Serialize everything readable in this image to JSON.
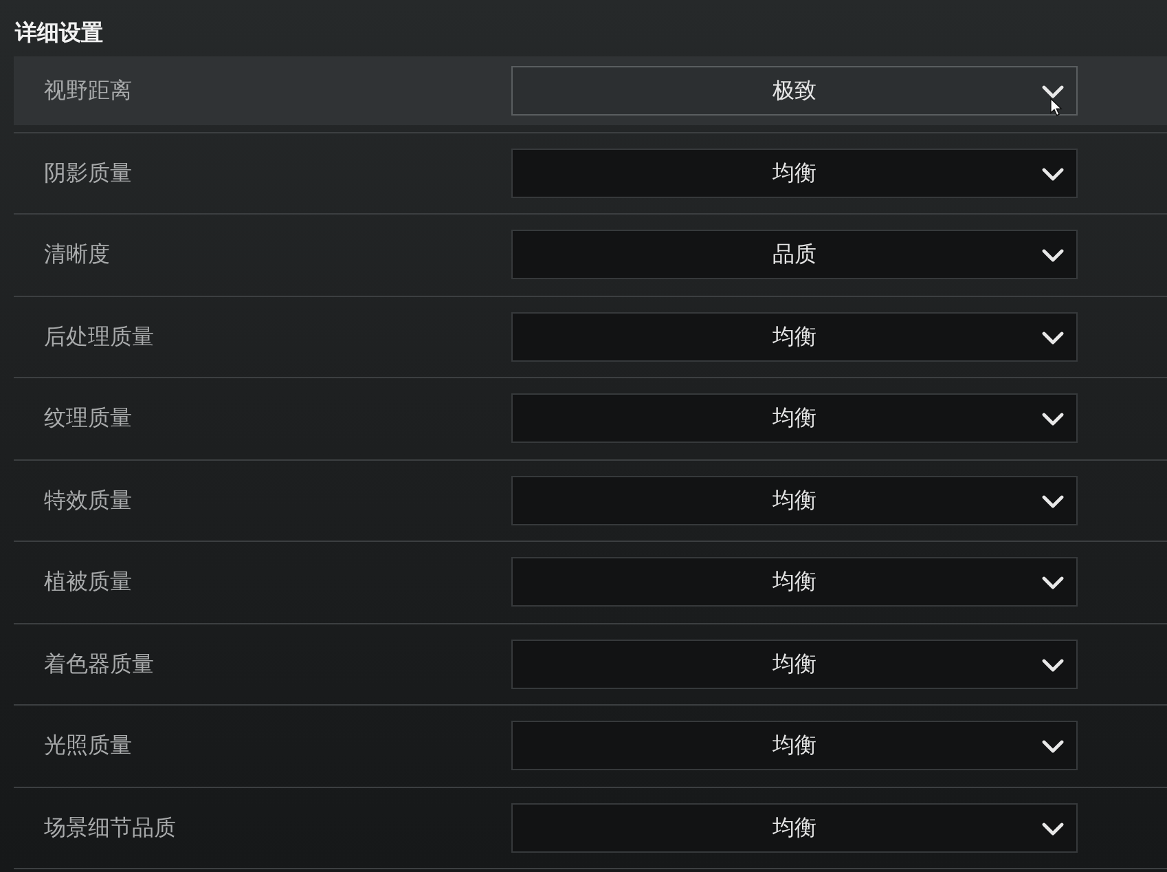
{
  "section_title": "详细设置",
  "settings": [
    {
      "label": "视野距离",
      "value": "极致",
      "highlighted": true
    },
    {
      "label": "阴影质量",
      "value": "均衡",
      "highlighted": false
    },
    {
      "label": "清晰度",
      "value": "品质",
      "highlighted": false
    },
    {
      "label": "后处理质量",
      "value": "均衡",
      "highlighted": false
    },
    {
      "label": "纹理质量",
      "value": "均衡",
      "highlighted": false
    },
    {
      "label": "特效质量",
      "value": "均衡",
      "highlighted": false
    },
    {
      "label": "植被质量",
      "value": "均衡",
      "highlighted": false
    },
    {
      "label": "着色器质量",
      "value": "均衡",
      "highlighted": false
    },
    {
      "label": "光照质量",
      "value": "均衡",
      "highlighted": false
    },
    {
      "label": "场景细节品质",
      "value": "均衡",
      "highlighted": false
    }
  ]
}
